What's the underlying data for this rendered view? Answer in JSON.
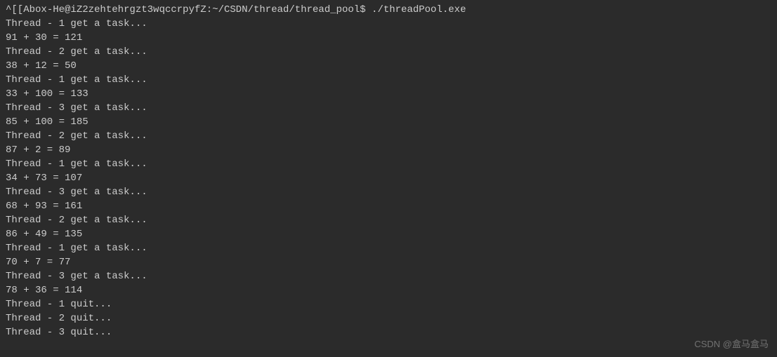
{
  "terminal": {
    "prompt": {
      "prefix": "^[[A",
      "user_host": "box-He@iZ2zehtehrgzt3wqccrpyfZ",
      "path": "~/CSDN/thread/thread_pool",
      "separator": "$",
      "command": "./threadPool.exe"
    },
    "lines": [
      "Thread - 1 get a task...",
      "91 + 30 = 121",
      "Thread - 2 get a task...",
      "38 + 12 = 50",
      "Thread - 1 get a task...",
      "33 + 100 = 133",
      "Thread - 3 get a task...",
      "85 + 100 = 185",
      "Thread - 2 get a task...",
      "87 + 2 = 89",
      "Thread - 1 get a task...",
      "34 + 73 = 107",
      "Thread - 3 get a task...",
      "68 + 93 = 161",
      "Thread - 2 get a task...",
      "86 + 49 = 135",
      "Thread - 1 get a task...",
      "70 + 7 = 77",
      "Thread - 3 get a task...",
      "78 + 36 = 114",
      "Thread - 1 quit...",
      "Thread - 2 quit...",
      "Thread - 3 quit..."
    ]
  },
  "watermark": "CSDN @盒马盒马"
}
